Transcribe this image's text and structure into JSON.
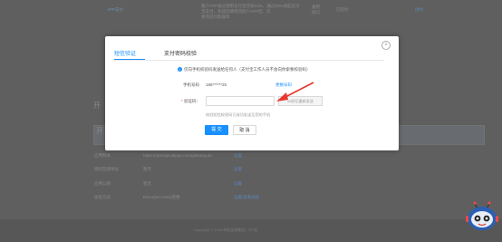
{
  "background": {
    "top_row": {
      "col1": "APP支付",
      "col2_lines": [
        "集户APP通过调用支付宝开放SDK，通过SDK调起支付",
        "宝支付，完成后跳转回商户APP后，交",
        "易完成付款操作"
      ],
      "col3_lines": [
        "通用",
        "接口"
      ],
      "col4": "已签约",
      "col5": "接约"
    },
    "left_stub1": "开",
    "left_stub2": "开",
    "rows": [
      {
        "label": "应用网关",
        "value": "https://openapi.alipay.com/gateway.do",
        "action": "设置"
      },
      {
        "label": "授权回调地址",
        "value": "暂无",
        "action": "设置"
      },
      {
        "label": "应用公钥",
        "value": "暂无",
        "action": "设置"
      },
      {
        "label": "加签方式",
        "value": "RSA2(SHA256)密钥",
        "action": "设置/查看加签"
      }
    ],
    "footer": "Copyright © 2018 蚂蚁金服集团 | ICP证"
  },
  "modal": {
    "tabs": [
      {
        "label": "短信验证",
        "active": true
      },
      {
        "label": "支付密码校验",
        "active": false
      }
    ],
    "notice": "仅向手机校验码发送给任何人（支付宝工作人员不会向你索要校验码）",
    "phone_label": "手机号码",
    "phone_value": "186******25",
    "change_phone": "更换号码",
    "code_label": "验证码",
    "code_placeholder": "",
    "send_button": "58秒后重新发送",
    "hint": "校验短信校验码已成功发送至您的手机",
    "confirm": "提 交",
    "cancel": "取 消",
    "close": "×"
  },
  "colors": {
    "accent": "#1890ff",
    "arrow": "#e8372c"
  }
}
